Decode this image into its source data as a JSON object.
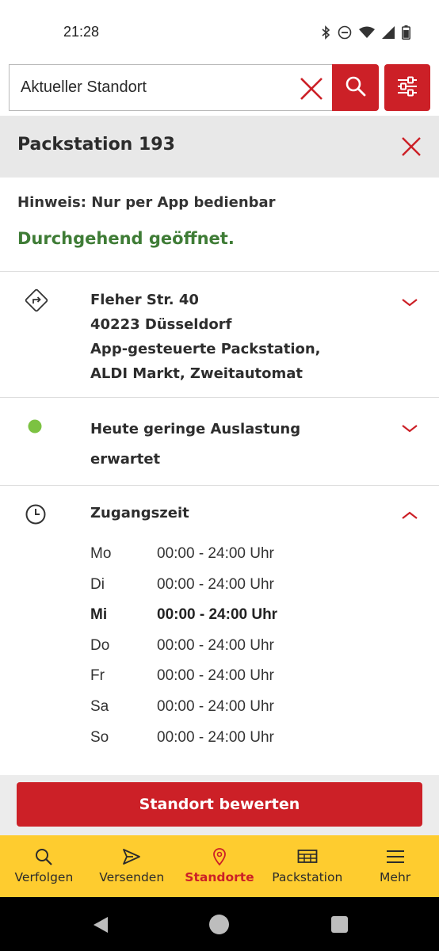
{
  "status_bar": {
    "time": "21:28"
  },
  "search": {
    "value": "Aktueller Standort"
  },
  "location": {
    "title": "Packstation 193",
    "hint": "Hinweis: Nur per App bedienbar",
    "open_status": "Durchgehend geöffnet.",
    "address_lines": [
      "Fleher Str. 40",
      "40223 Düsseldorf",
      "App-gesteuerte Packstation,",
      "ALDI Markt, Zweitautomat"
    ],
    "load_text": "Heute geringe Auslastung erwartet",
    "access_title": "Zugangszeit",
    "hours": [
      {
        "day": "Mo",
        "time": "00:00 - 24:00 Uhr"
      },
      {
        "day": "Di",
        "time": "00:00 - 24:00 Uhr"
      },
      {
        "day": "Mi",
        "time": "00:00 - 24:00 Uhr"
      },
      {
        "day": "Do",
        "time": "00:00 - 24:00 Uhr"
      },
      {
        "day": "Fr",
        "time": "00:00 - 24:00 Uhr"
      },
      {
        "day": "Sa",
        "time": "00:00 - 24:00 Uhr"
      },
      {
        "day": "So",
        "time": "00:00 - 24:00 Uhr"
      }
    ],
    "today_index": 2,
    "rate_button": "Standort bewerten"
  },
  "tabs": [
    {
      "label": "Verfolgen",
      "icon": "search-icon"
    },
    {
      "label": "Versenden",
      "icon": "send-icon"
    },
    {
      "label": "Standorte",
      "icon": "location-pin-icon",
      "active": true
    },
    {
      "label": "Packstation",
      "icon": "packstation-icon"
    },
    {
      "label": "Mehr",
      "icon": "menu-icon"
    }
  ],
  "colors": {
    "brand_red": "#cc2027",
    "brand_yellow": "#fecc2f",
    "open_green": "#3f7c36",
    "load_dot_green": "#7cc242"
  }
}
